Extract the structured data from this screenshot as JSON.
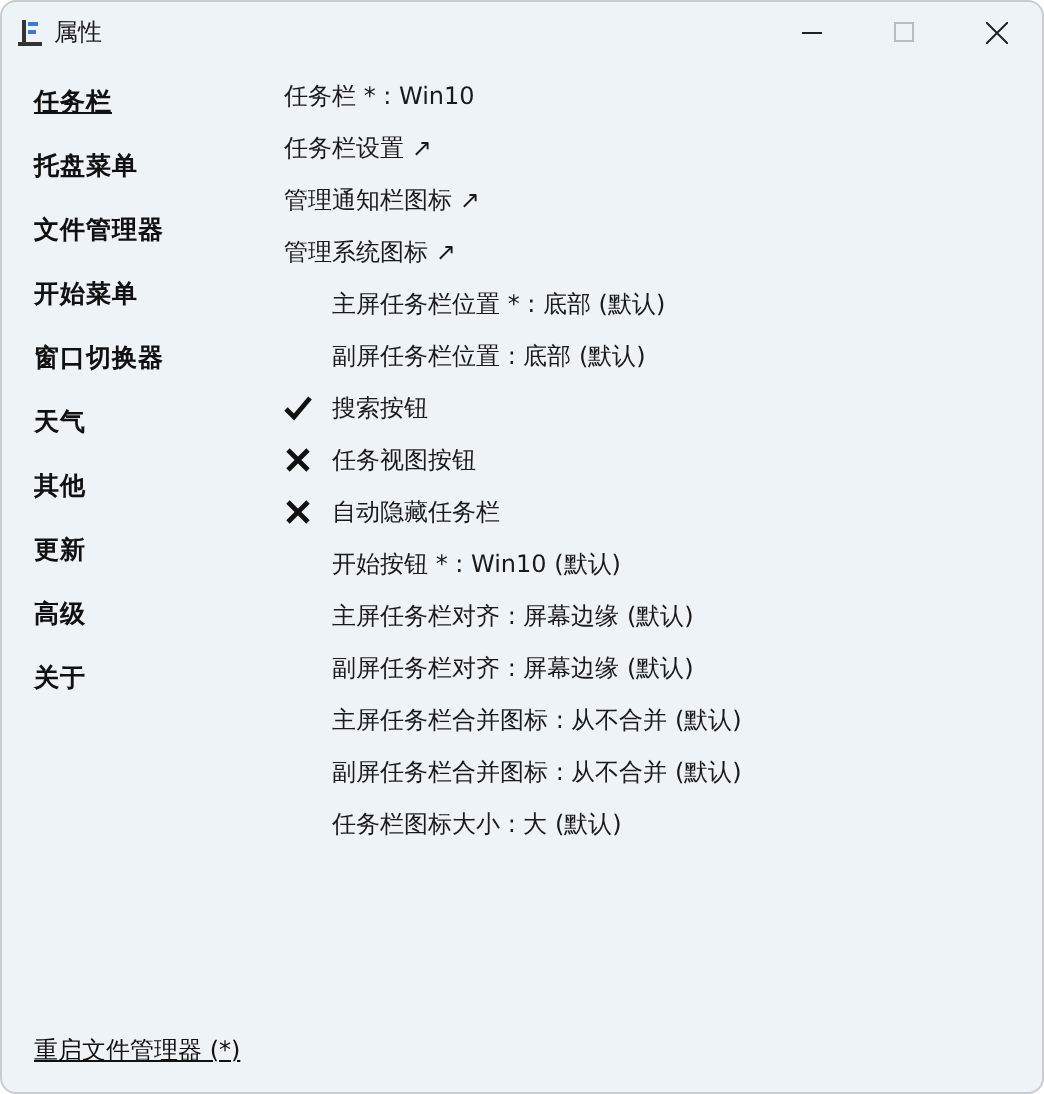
{
  "window": {
    "title": "属性"
  },
  "sidebar": {
    "items": [
      {
        "label": "任务栏",
        "selected": true
      },
      {
        "label": "托盘菜单",
        "selected": false
      },
      {
        "label": "文件管理器",
        "selected": false
      },
      {
        "label": "开始菜单",
        "selected": false
      },
      {
        "label": "窗口切换器",
        "selected": false
      },
      {
        "label": "天气",
        "selected": false
      },
      {
        "label": "其他",
        "selected": false
      },
      {
        "label": "更新",
        "selected": false
      },
      {
        "label": "高级",
        "selected": false
      },
      {
        "label": "关于",
        "selected": false
      }
    ]
  },
  "settings": [
    {
      "kind": "setting",
      "label": "任务栏 * : Win10"
    },
    {
      "kind": "link",
      "label": "任务栏设置 ↗"
    },
    {
      "kind": "link",
      "label": "管理通知栏图标 ↗"
    },
    {
      "kind": "link",
      "label": "管理系统图标 ↗"
    },
    {
      "kind": "sub",
      "label": "主屏任务栏位置 * : 底部 (默认)"
    },
    {
      "kind": "sub",
      "label": "副屏任务栏位置 : 底部 (默认)"
    },
    {
      "kind": "toggle",
      "label": "搜索按钮",
      "checked": true
    },
    {
      "kind": "toggle",
      "label": "任务视图按钮",
      "checked": false
    },
    {
      "kind": "toggle",
      "label": "自动隐藏任务栏",
      "checked": false
    },
    {
      "kind": "sub",
      "label": "开始按钮 * : Win10 (默认)"
    },
    {
      "kind": "sub",
      "label": "主屏任务栏对齐 : 屏幕边缘 (默认)"
    },
    {
      "kind": "sub",
      "label": "副屏任务栏对齐 : 屏幕边缘 (默认)"
    },
    {
      "kind": "sub",
      "label": "主屏任务栏合并图标 : 从不合并 (默认)"
    },
    {
      "kind": "sub",
      "label": "副屏任务栏合并图标 : 从不合并 (默认)"
    },
    {
      "kind": "sub",
      "label": "任务栏图标大小 : 大 (默认)"
    }
  ],
  "footer": {
    "link": "重启文件管理器 (*)"
  }
}
